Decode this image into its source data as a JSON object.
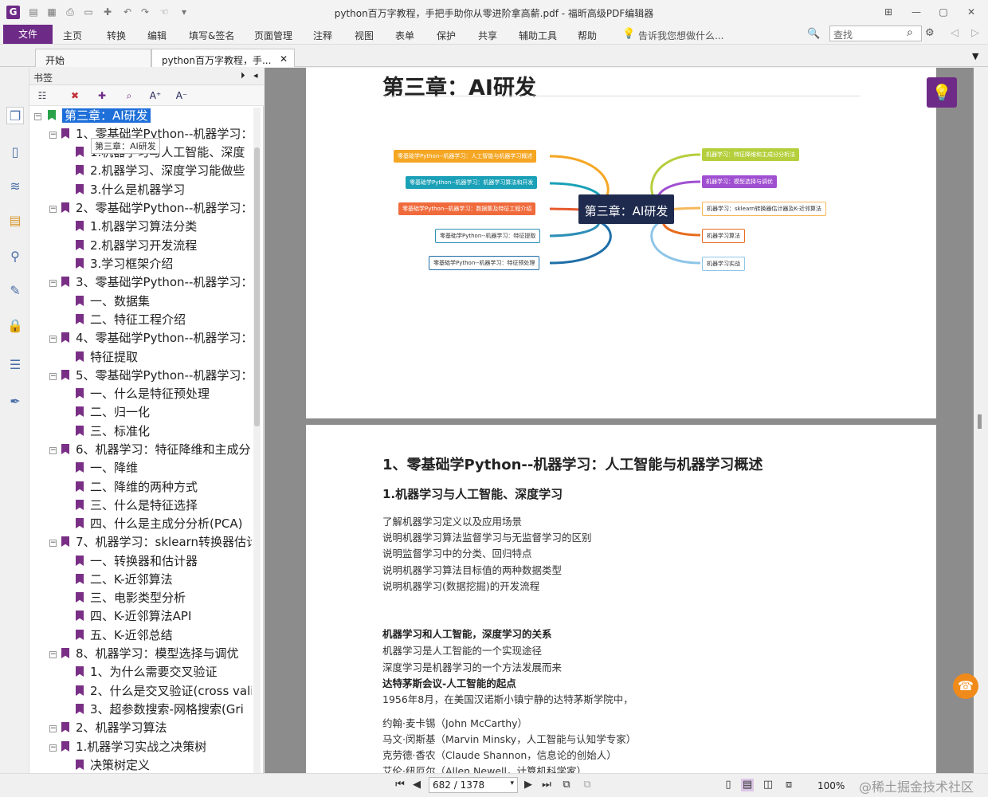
{
  "window": {
    "title": "python百万字教程，手把手助你从零进阶拿高薪.pdf - 福昕高级PDF编辑器"
  },
  "menu": {
    "file": "文件",
    "items": [
      "主页",
      "转换",
      "编辑",
      "填写&签名",
      "页面管理",
      "注释",
      "视图",
      "表单",
      "保护",
      "共享",
      "辅助工具",
      "帮助"
    ],
    "tell_me": "告诉我您想做什么...",
    "search_placeholder": "查找"
  },
  "tabs": [
    "开始",
    "python百万字教程，手..."
  ],
  "bookmarks": {
    "title": "书签",
    "tooltip": "第三章：AI研发",
    "root": "第三章：AI研发",
    "items": [
      "1、零基础学Python--机器学习：",
      "1.机器学习与人工智能、深度",
      "2.机器学习、深度学习能做些",
      "3.什么是机器学习",
      "2、零基础学Python--机器学习：",
      "1.机器学习算法分类",
      "2.机器学习开发流程",
      "3.学习框架介绍",
      "3、零基础学Python--机器学习：",
      "一、数据集",
      "二、特征工程介绍",
      "4、零基础学Python--机器学习：",
      "特征提取",
      "5、零基础学Python--机器学习：",
      "一、什么是特征预处理",
      "二、归一化",
      "三、标准化",
      "6、机器学习：特征降维和主成分",
      "一、降维",
      "二、降维的两种方式",
      "三、什么是特征选择",
      "四、什么是主成分分析(PCA)",
      "7、机器学习：sklearn转换器估计",
      "一、转换器和估计器",
      "二、K-近邻算法",
      "三、电影类型分析",
      "四、K-近邻算法API",
      "五、K-近邻总结",
      "8、机器学习：模型选择与调优",
      "1、为什么需要交叉验证",
      "2、什么是交叉验证(cross vali",
      "3、超参数搜索-网格搜索(Gri",
      "2、机器学习算法",
      "1.机器学习实战之决策树",
      "决策树定义"
    ]
  },
  "page1": {
    "chapter_title": "第三章：AI研发",
    "mindmap": {
      "center": "第三章：AI研发",
      "left": [
        "零基础学Python--机器学习：人工智能与机器学习概述",
        "零基础学Python--机器学习：机器学习算法和开发",
        "零基础学Python--机器学习：数据集及特征工程介绍",
        "零基础学Python--机器学习：特征提取",
        "零基础学Python--机器学习：特征预处理"
      ],
      "right": [
        "机器学习：特征降维和主成分分析法",
        "机器学习：模型选择与调优",
        "机器学习：sklearn转换器估计器及K-近邻算法",
        "机器学习算法",
        "机器学习实战"
      ]
    }
  },
  "page2": {
    "h1": "1、零基础学Python--机器学习：人工智能与机器学习概述",
    "h2": "1.机器学习与人工智能、深度学习",
    "goals": [
      "了解机器学习定义以及应用场景",
      "说明机器学习算法监督学习与无监督学习的区别",
      "说明监督学习中的分类、回归特点",
      "说明机器学习算法目标值的两种数据类型",
      "说明机器学习(数据挖掘)的开发流程"
    ],
    "relation_title": "机器学习和人工智能，深度学习的关系",
    "relation_lines": [
      "机器学习是人工智能的一个实现途径",
      "深度学习是机器学习的一个方法发展而来"
    ],
    "dartmouth_title": "达特茅斯会议-人工智能的起点",
    "dartmouth_line": "1956年8月，在美国汉诺斯小镇宁静的达特茅斯学院中，",
    "people": [
      "约翰·麦卡锡（John McCarthy）",
      "马文·闵斯基（Marvin Minsky，人工智能与认知学专家）",
      "克劳德·香农（Claude Shannon，信息论的创始人）",
      "艾伦·纽厄尔（Allen Newell，计算机科学家）"
    ]
  },
  "status": {
    "page": "682 / 1378",
    "zoom": "100%",
    "watermark": "@稀土掘金技术社区"
  }
}
